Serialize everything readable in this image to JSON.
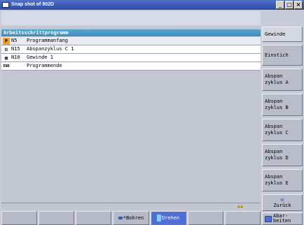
{
  "window": {
    "title": "Snap shot of 802D",
    "minimize_glyph": "_",
    "maximize_glyph": "□",
    "close_glyph": "×"
  },
  "program": {
    "header": "Arbeitsschrittprogramm",
    "rows": [
      {
        "icon": "P",
        "icon_name": "program-start-icon",
        "label": "N5",
        "text": "Programmanfang"
      },
      {
        "icon": "⊡",
        "icon_name": "roughing-cycle-icon",
        "label": "N15",
        "text": "Abspanzyklus C 1"
      },
      {
        "icon": "▦",
        "icon_name": "thread-icon",
        "label": "N10",
        "text": "Gewinde 1"
      },
      {
        "icon": "END",
        "icon_name": "program-end-icon",
        "label": "",
        "text": "Programmende"
      }
    ]
  },
  "vertical_softkeys": [
    {
      "name": "gewinde-button",
      "label": "Gewinde"
    },
    {
      "name": "einstich-button",
      "label": "Einstich"
    },
    {
      "name": "abspanzyklus-a-button",
      "label": "Abspan zyklus A"
    },
    {
      "name": "abspanzyklus-b-button",
      "label": "Abspan zyklus B"
    },
    {
      "name": "abspanzyklus-c-button",
      "label": "Abspan zyklus C"
    },
    {
      "name": "abspanzyklus-d-button",
      "label": "Abspan zyklus D"
    },
    {
      "name": "abspanzyklus-e-button",
      "label": "Abspan zyklus E"
    },
    {
      "name": "zurueck-button",
      "label": "Zurück",
      "arrow": "«"
    },
    {
      "name": "abarbeiten-button",
      "label": "Abar- beiten"
    }
  ],
  "horizontal_softkeys": {
    "bohren": "Bohren",
    "bohren_marker": "*",
    "drehen": "Drehen"
  },
  "status": {
    "icon_glyph": "▲▲"
  }
}
